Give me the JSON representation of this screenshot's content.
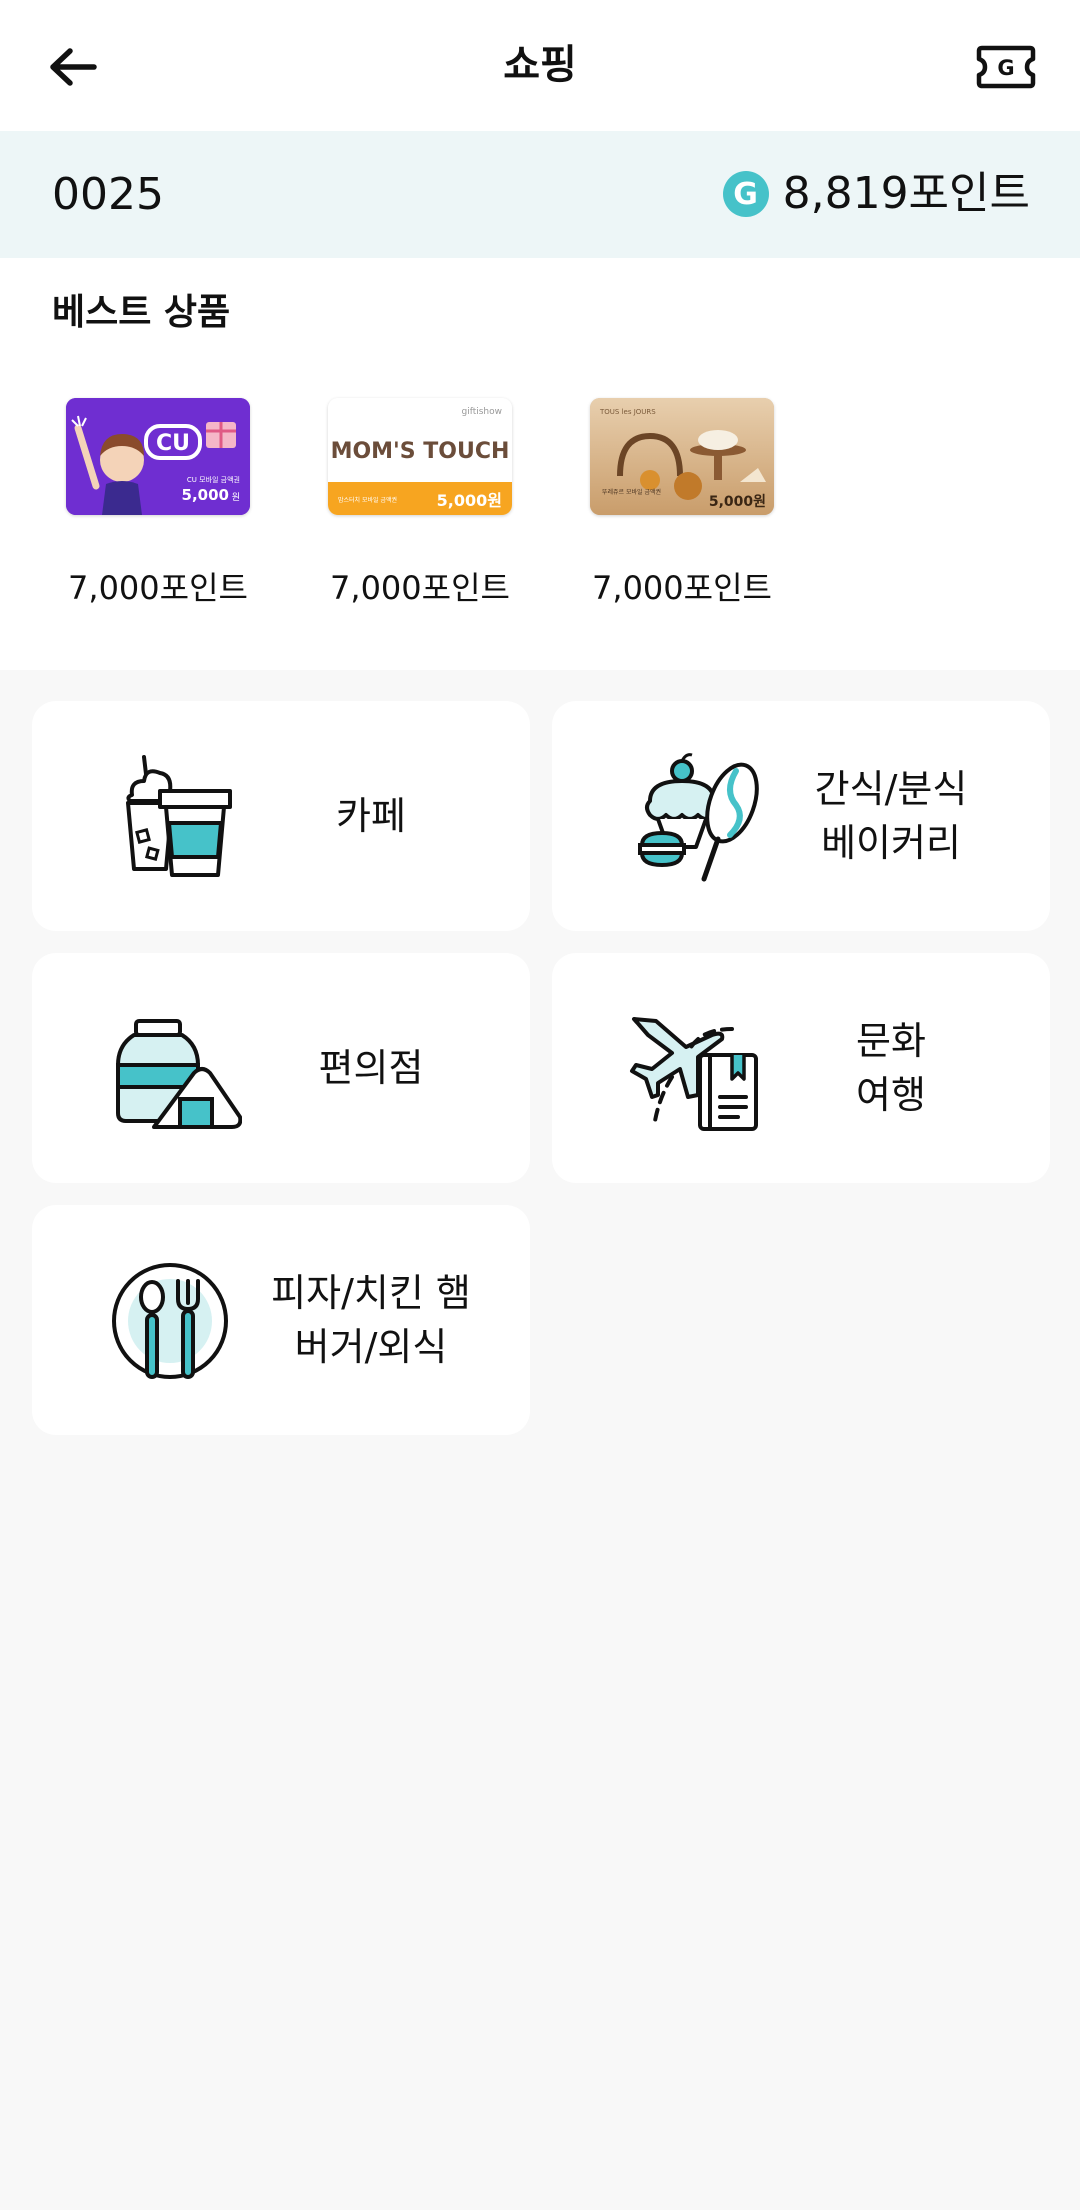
{
  "header": {
    "title": "쇼핑",
    "back_icon": "arrow-left-icon",
    "ticket_icon": "g-ticket-icon",
    "ticket_letter": "G"
  },
  "account": {
    "member_id": "0025",
    "coin_letter": "G",
    "points": "8,819포인트",
    "coin_color": "#46c2c9"
  },
  "best_products": {
    "title": "베스트 상품",
    "items": [
      {
        "price": "7,000포인트",
        "card": {
          "brand": "CU",
          "caption": "CU 모바일 금액권",
          "amount": "5,000",
          "unit": "원"
        }
      },
      {
        "price": "7,000포인트",
        "card": {
          "brand": "MOM'S TOUCH",
          "publisher": "giftishow",
          "caption": "맘스터치 모바일 금액권",
          "amount": "5,000원"
        }
      },
      {
        "price": "7,000포인트",
        "card": {
          "brand": "TOUS les JOURS",
          "caption": "뚜레쥬르 모바일 금액권",
          "amount": "5,000원"
        }
      }
    ]
  },
  "categories": [
    {
      "label": "카페",
      "icon": "cafe-drinks-icon"
    },
    {
      "label": "간식/분식\n베이커리",
      "icon": "snack-bakery-icon"
    },
    {
      "label": "편의점",
      "icon": "convenience-store-icon"
    },
    {
      "label": "문화\n여행",
      "icon": "culture-travel-icon"
    },
    {
      "label": "피자/치킨 햄\n버거/외식",
      "icon": "dining-plate-icon"
    }
  ],
  "colors": {
    "accent": "#46c2c9",
    "points_bar_bg": "#edf6f7",
    "page_bg": "#f8f8f8"
  }
}
